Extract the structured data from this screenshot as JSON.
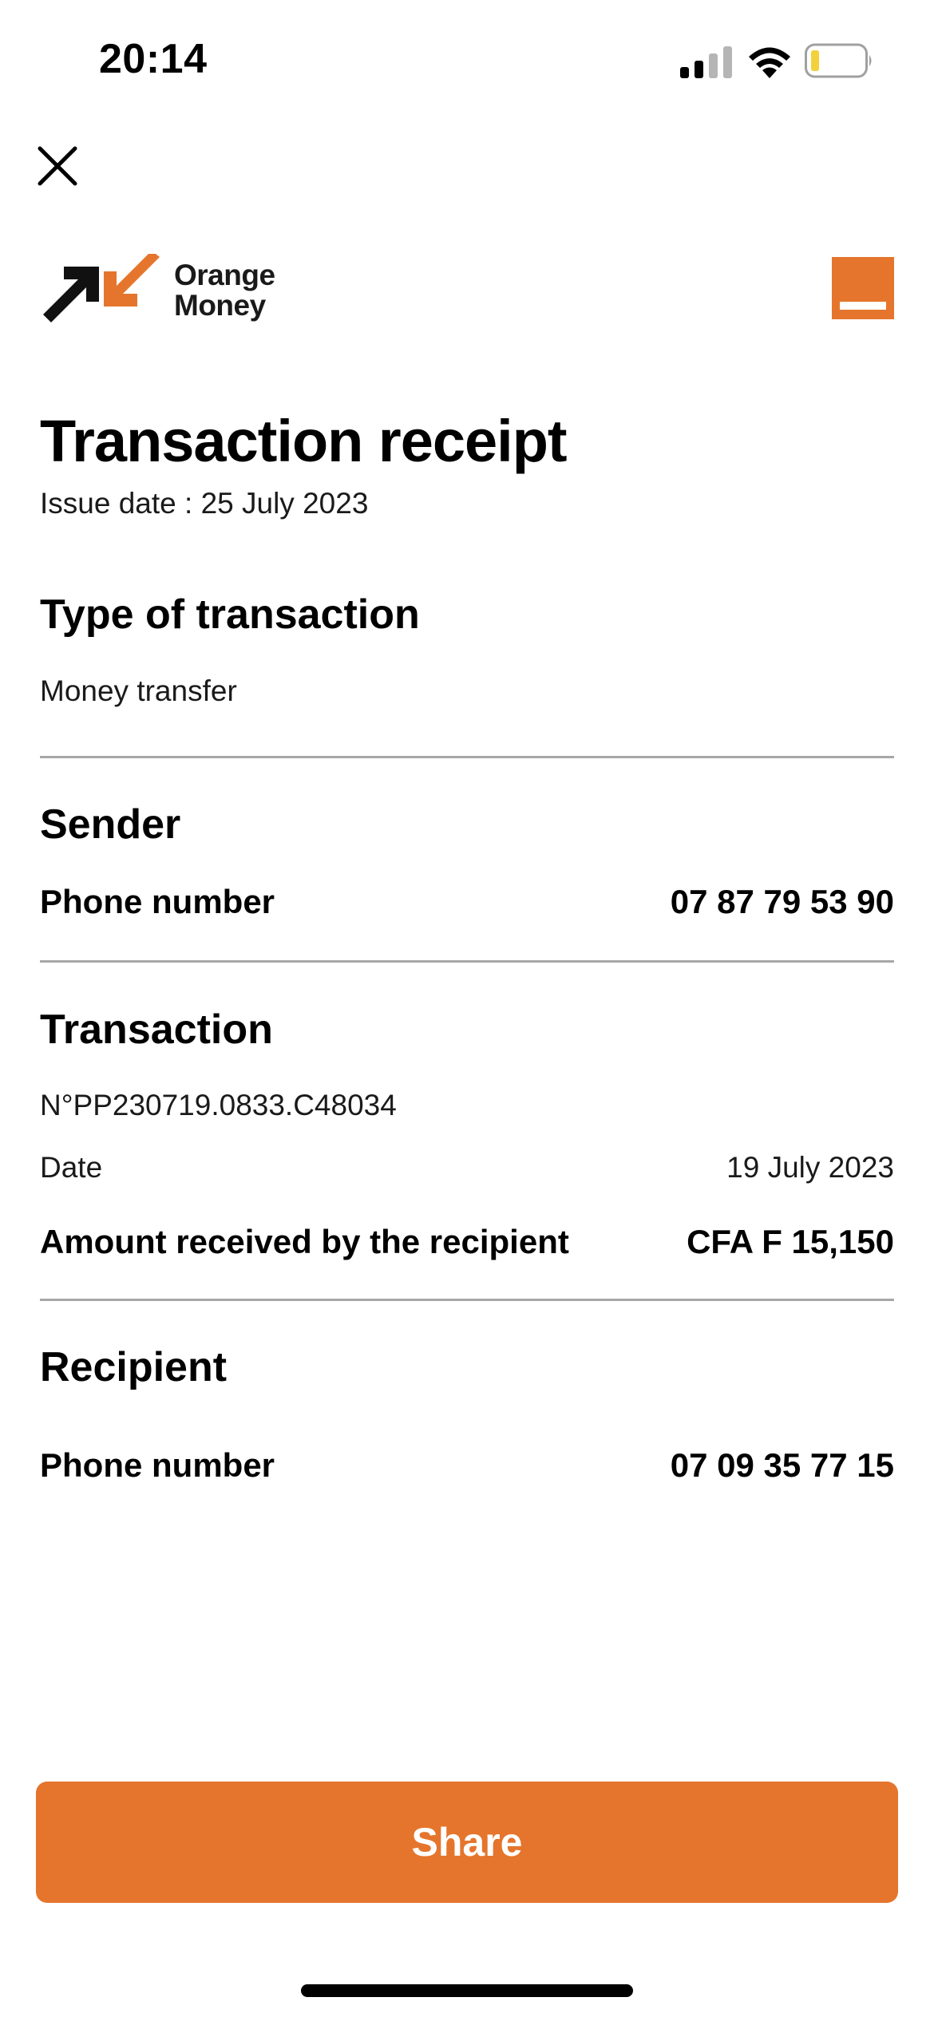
{
  "status_bar": {
    "time": "20:14",
    "icons": [
      "signal-icon",
      "wifi-icon",
      "battery-icon"
    ]
  },
  "header": {
    "close_icon": "close-icon",
    "brand_line1": "Orange",
    "brand_line2": "Money"
  },
  "receipt": {
    "title": "Transaction receipt",
    "issue_date": "Issue date : 25 July 2023",
    "type_section": {
      "heading": "Type of transaction",
      "value": "Money transfer"
    },
    "sender_section": {
      "heading": "Sender",
      "phone_label": "Phone number",
      "phone_value": "07 87 79 53 90"
    },
    "transaction_section": {
      "heading": "Transaction",
      "reference": "N°PP230719.0833.C48034",
      "date_label": "Date",
      "date_value": "19 July 2023",
      "amount_label": "Amount received by the recipient",
      "amount_value": "CFA F 15,150"
    },
    "recipient_section": {
      "heading": "Recipient",
      "phone_label": "Phone number",
      "phone_value": "07 09 35 77 15"
    }
  },
  "actions": {
    "share_label": "Share"
  },
  "colors": {
    "accent": "#e5752c",
    "divider": "#a7a7a7",
    "text": "#000000",
    "battery_level": "#f2d13c"
  }
}
